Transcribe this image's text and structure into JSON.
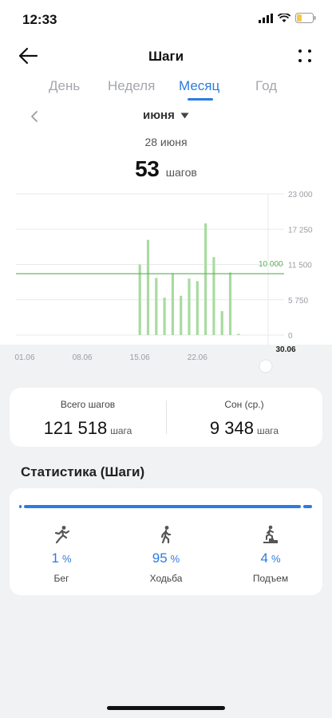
{
  "status": {
    "time": "12:33"
  },
  "header": {
    "title": "Шаги"
  },
  "tabs": [
    {
      "label": "День"
    },
    {
      "label": "Неделя"
    },
    {
      "label": "Месяц"
    },
    {
      "label": "Год"
    }
  ],
  "active_tab": "Месяц",
  "period": {
    "label": "июня"
  },
  "selected": {
    "date": "28 июня",
    "value": "53",
    "unit": "шагов"
  },
  "chart_data": {
    "type": "bar",
    "categories": [
      "01.06",
      "02.06",
      "03.06",
      "04.06",
      "05.06",
      "06.06",
      "07.06",
      "08.06",
      "09.06",
      "10.06",
      "11.06",
      "12.06",
      "13.06",
      "14.06",
      "15.06",
      "16.06",
      "17.06",
      "18.06",
      "19.06",
      "20.06",
      "21.06",
      "22.06",
      "23.06",
      "24.06",
      "25.06",
      "26.06",
      "27.06",
      "28.06",
      "29.06",
      "30.06"
    ],
    "values": [
      0,
      0,
      0,
      0,
      0,
      0,
      0,
      0,
      0,
      0,
      0,
      0,
      0,
      0,
      11500,
      15500,
      9300,
      6100,
      10100,
      6400,
      9200,
      8800,
      18200,
      12700,
      3900,
      10200,
      53,
      0,
      0,
      0
    ],
    "x_tick_labels": [
      "01.06",
      "08.06",
      "15.06",
      "22.06",
      "30.06"
    ],
    "y_tick_labels": [
      "23 000",
      "17 250",
      "11 500",
      "5 750",
      "0"
    ],
    "ylim": [
      0,
      23000
    ],
    "goal": {
      "value": 10000,
      "label": "10 000"
    },
    "bar_color": "#a8dba0",
    "goal_color": "#5ab055",
    "grid": true,
    "selected_category": "28.06"
  },
  "summary": {
    "total_label": "Всего шагов",
    "total_value": "121 518",
    "total_unit": "шага",
    "sleep_label": "Сон (ср.)",
    "sleep_value": "9 348",
    "sleep_unit": "шага"
  },
  "stats": {
    "title": "Статистика (Шаги)",
    "items": [
      {
        "value": "1",
        "unit": "%",
        "label": "Бег",
        "icon": "running-icon"
      },
      {
        "value": "95",
        "unit": "%",
        "label": "Ходьба",
        "icon": "walking-icon"
      },
      {
        "value": "4",
        "unit": "%",
        "label": "Подъем",
        "icon": "climbing-icon"
      }
    ],
    "accent": "#2d7be0"
  }
}
